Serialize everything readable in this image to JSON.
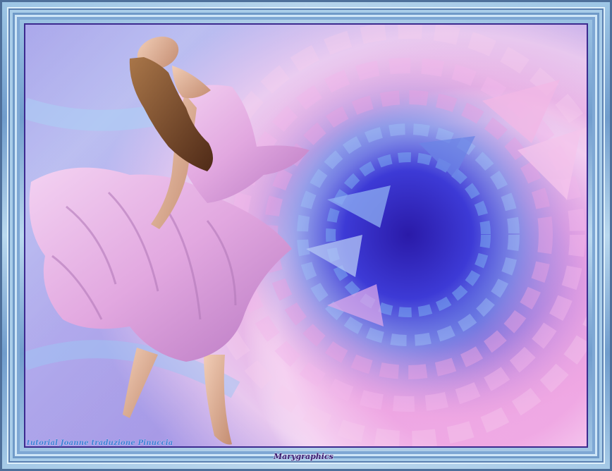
{
  "artwork": {
    "subject": "woman in flowing pink dress dancing",
    "background": "blue and pink radial swirl",
    "colors": {
      "frame_light": "#b9d8ef",
      "frame_dark": "#4e6f9a",
      "swirl_center": "#2b1fb0",
      "swirl_pink": "#ec9fdc",
      "dress_pink": "#e7b4e6",
      "dress_shadow": "#a16bb0",
      "skin": "#e2b59a",
      "hair": "#7a4a2c"
    }
  },
  "texts": {
    "credit": "tutorial Joanne traduzione Pinuccia",
    "signature": "Marygraphics"
  }
}
